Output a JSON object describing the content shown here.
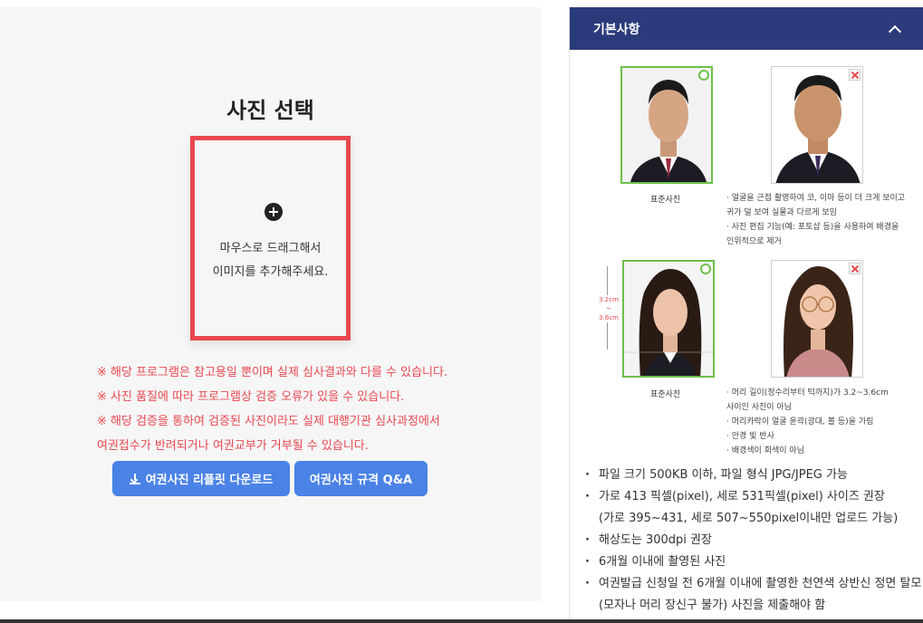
{
  "left": {
    "title": "사진 선택",
    "drop_line1": "마우스로 드래그해서",
    "drop_line2": "이미지를 추가해주세요.",
    "warnings": [
      "※ 해당 프로그램은 참고용일 뿐이며 실제 심사결과와 다를 수 있습니다.",
      "※ 사진 품질에 따라 프로그램상 검증 오류가 있을 수 있습니다.",
      "※ 해당 검증을 통하여 검증된 사진이라도 실제 대행기관 심사과정에서",
      "여권접수가 반려되거나 여권교부가 거부될 수 있습니다."
    ],
    "download_button": "여권사진 리플릿 다운로드",
    "qa_button": "여권사진 규격 Q&A"
  },
  "right": {
    "header_title": "기본사항",
    "caption_standard": "표준사진",
    "notes_1": [
      "· 얼굴을 근접 촬영하여 코, 이마 등이 더 크게 보이고",
      "  귀가 덜 보여 실물과 다르게 보임",
      "· 사진 편집 기능(예: 포토샵 등)을 사용하여 배경을",
      "  인위적으로 제거"
    ],
    "notes_2": [
      "· 머리 길이(정수리부터 턱까지)가 3.2~3.6cm",
      "  사이인 사진이 아님",
      "· 머리카락이 얼굴 윤곽(광대, 볼 등)을 가림",
      "· 안경 빛 반사",
      "· 배경색이 회색이 아님"
    ],
    "measure_label": [
      "3.2cm",
      "~",
      "3.6cm"
    ],
    "specs": [
      {
        "text": "파일 크기 500KB 이하, 파일 형식 JPG/JPEG 가능",
        "bullet": true
      },
      {
        "text": "가로 413 픽셀(pixel), 세로 531픽셀(pixel) 사이즈 권장",
        "bullet": true
      },
      {
        "text": "(가로 395~431, 세로 507~550pixel이내만 업로드 가능)",
        "bullet": false
      },
      {
        "text": "해상도는 300dpi 권장",
        "bullet": true
      },
      {
        "text": "6개월 이내에 촬영된 사진",
        "bullet": true
      },
      {
        "text": "여권발급 신청일 전 6개월 이내에 촬영한 천연색 상반신 정면 탈모",
        "bullet": true
      },
      {
        "text": "(모자나 머리 장신구 불가) 사진을 제출해야 함",
        "bullet": false
      }
    ]
  },
  "colors": {
    "accent": "#4a82e6",
    "warning": "#e8484f",
    "header": "#2b3a7a",
    "ok": "#6cc04a"
  }
}
